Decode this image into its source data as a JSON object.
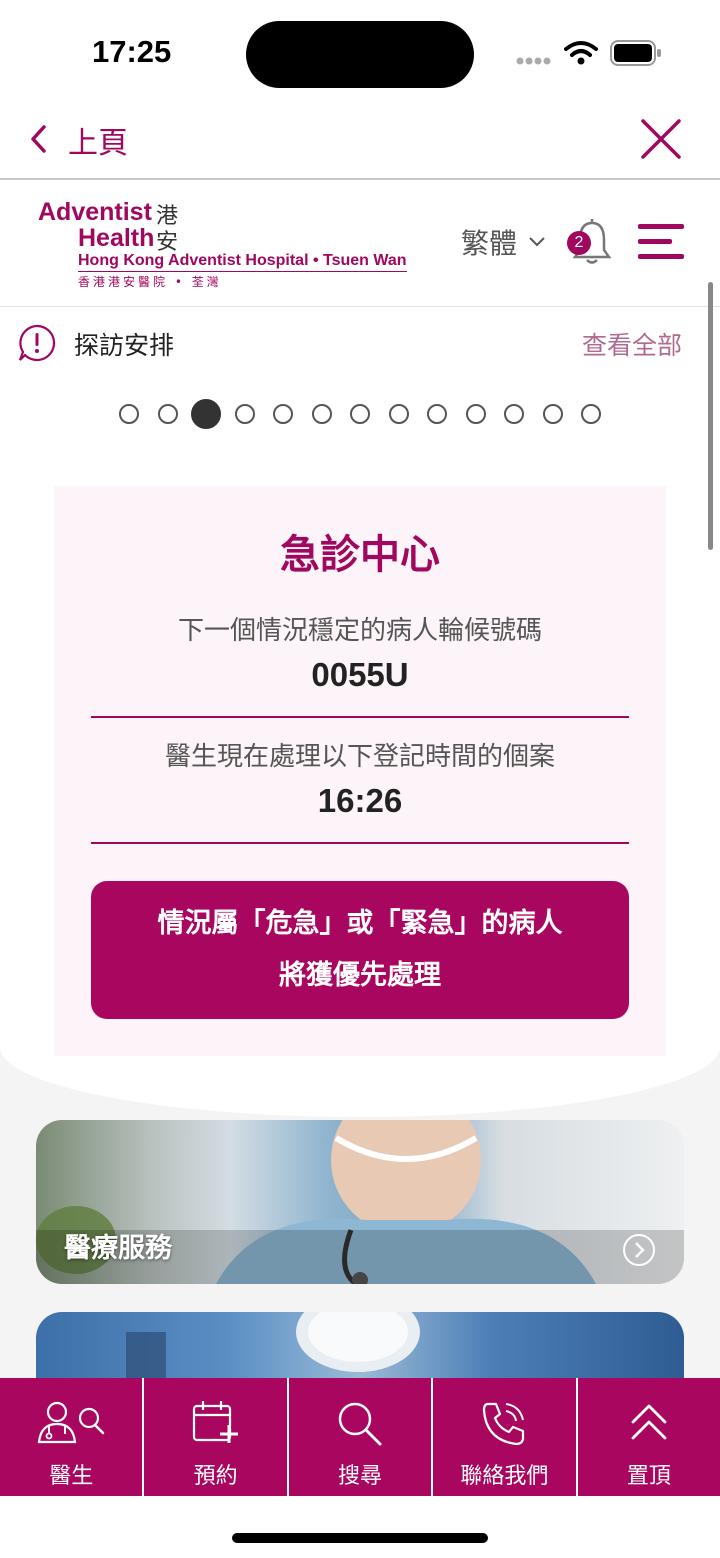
{
  "status_bar": {
    "time": "17:25"
  },
  "nav": {
    "back_label": "上頁"
  },
  "header": {
    "logo": {
      "line1": "Adventist",
      "line1_cn": "港",
      "line2": "Health",
      "line2_cn": "安",
      "hospital_en": "Hong Kong Adventist Hospital • Tsuen Wan",
      "hospital_cn": "香港港安醫院 • 荃灣"
    },
    "language": "繁體",
    "notification_count": "2"
  },
  "notice": {
    "title": "探訪安排",
    "view_all": "查看全部",
    "pagination": {
      "total": 13,
      "active_index": 2
    }
  },
  "er_card": {
    "title": "急診中心",
    "next_label": "下一個情況穩定的病人輪候號碼",
    "next_value": "0055U",
    "time_label": "醫生現在處理以下登記時間的個案",
    "time_value": "16:26",
    "cta_line1": "情況屬「危急」或「緊急」的病人",
    "cta_line2": "將獲優先處理"
  },
  "banners": [
    {
      "label": "醫療服務"
    }
  ],
  "tabbar": [
    {
      "label": "醫生",
      "icon": "doctor-search-icon"
    },
    {
      "label": "預約",
      "icon": "calendar-add-icon"
    },
    {
      "label": "搜尋",
      "icon": "search-icon"
    },
    {
      "label": "聯絡我們",
      "icon": "phone-icon"
    },
    {
      "label": "置頂",
      "icon": "double-chevron-up-icon"
    }
  ],
  "colors": {
    "brand": "#a9075f",
    "card_bg": "#fcf4f8"
  }
}
